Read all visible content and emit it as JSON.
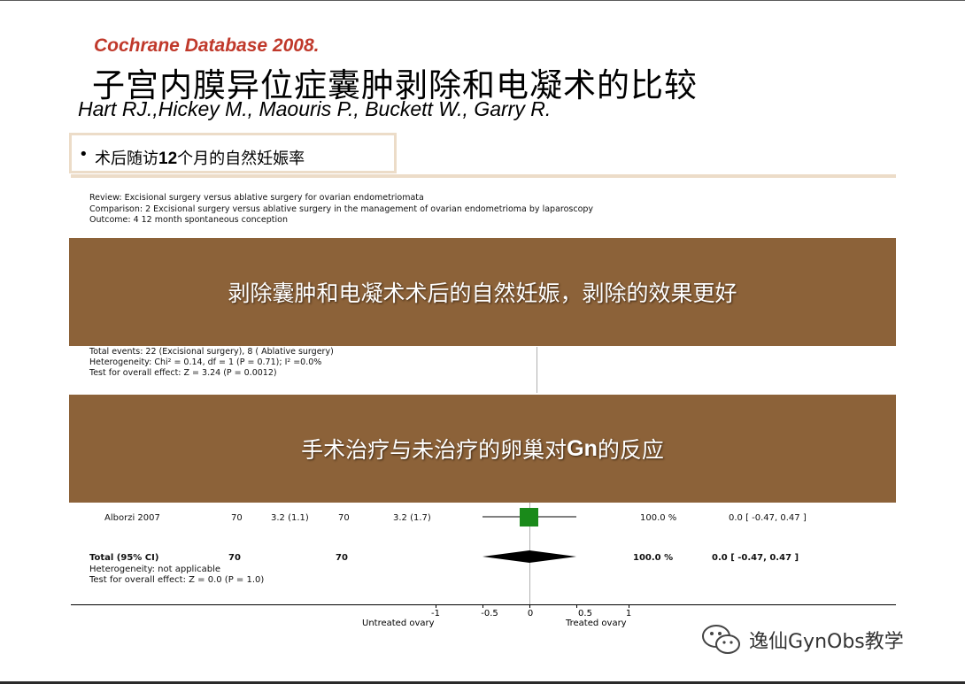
{
  "header": {
    "source": "Cochrane Database 2008.",
    "title": "子宫内膜异位症囊肿剥除和电凝术的比较",
    "authors": "Hart RJ.,Hickey M., Maouris P., Buckett W., Garry R."
  },
  "bullet": {
    "marker": "•",
    "prefix": "术后随访",
    "number": "12",
    "suffix": "个月的自然妊娠率"
  },
  "review": {
    "review": "Review:  Excisional surgery versus ablative surgery for ovarian endometriomata",
    "comparison": "Comparison:  2 Excisional surgery versus ablative surgery in the management of ovarian endometrioma by laparoscopy",
    "outcome": "Outcome:  4 12 month spontaneous conception"
  },
  "banners": {
    "first": "剥除囊肿和电凝术术后的自然妊娠，剥除的效果更好",
    "second_prefix": "手术治疗与未治疗的卵巢对",
    "second_bold": "Gn",
    "second_suffix": "的反应"
  },
  "analysis1": {
    "total_events": "Total events: 22 (Excisional surgery), 8 (  Ablative surgery)",
    "heterogeneity": "Heterogeneity: Chi² = 0.14, df = 1 (P = 0.71); I² =0.0%",
    "overall": "Test for overall effect: Z = 3.24 (P = 0.0012)"
  },
  "analysis2": {
    "study": {
      "name": "Alborzi 2007",
      "n1": "70",
      "mean_sd1": "3.2 (1.1)",
      "n2": "70",
      "mean_sd2": "3.2 (1.7)",
      "weight": "100.0 %",
      "ci": "0.0 [ -0.47, 0.47 ]"
    },
    "total": {
      "label": "Total (95% CI)",
      "n1": "70",
      "n2": "70",
      "weight": "100.0 %",
      "ci": "0.0 [ -0.47, 0.47 ]"
    },
    "heterogeneity": "Heterogeneity: not applicable",
    "overall": "Test for overall effect: Z = 0.0 (P = 1.0)"
  },
  "axis": {
    "ticks": [
      "-1",
      "-0.5",
      "0",
      "0.5",
      "1"
    ],
    "left_caption": "Untreated ovary",
    "right_caption": "Treated ovary"
  },
  "colors": {
    "source": "#c0392b",
    "banner": "#8c6239",
    "marker": "#1a8a1a"
  },
  "watermark": {
    "icon": "wechat-icon",
    "text": "逸仙GynObs教学"
  }
}
